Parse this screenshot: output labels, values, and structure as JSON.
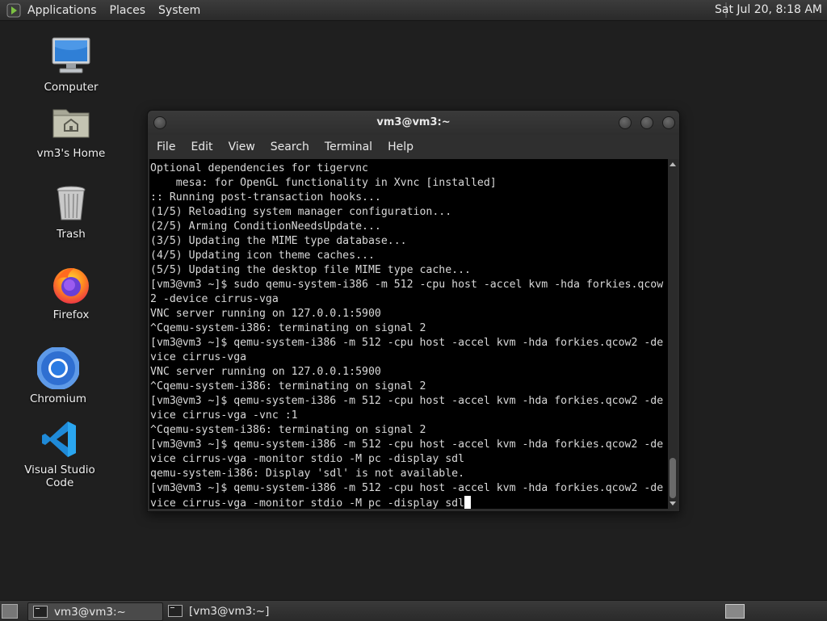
{
  "top_panel": {
    "menus": [
      "Applications",
      "Places",
      "System"
    ],
    "clock": "Sat Jul 20,  8:18 AM"
  },
  "desktop_icons": [
    {
      "label": "Computer",
      "icon": "computer-icon"
    },
    {
      "label": "vm3's Home",
      "icon": "home-folder-icon"
    },
    {
      "label": "Trash",
      "icon": "trash-icon"
    },
    {
      "label": "Firefox",
      "icon": "firefox-icon"
    },
    {
      "label": "Chromium",
      "icon": "chromium-icon"
    },
    {
      "label": "Visual Studio Code",
      "icon": "vscode-icon"
    }
  ],
  "window": {
    "title": "vm3@vm3:~",
    "menu": [
      "File",
      "Edit",
      "View",
      "Search",
      "Terminal",
      "Help"
    ],
    "terminal_lines": [
      "Optional dependencies for tigervnc",
      "    mesa: for OpenGL functionality in Xvnc [installed]",
      ":: Running post-transaction hooks...",
      "(1/5) Reloading system manager configuration...",
      "(2/5) Arming ConditionNeedsUpdate...",
      "(3/5) Updating the MIME type database...",
      "(4/5) Updating icon theme caches...",
      "(5/5) Updating the desktop file MIME type cache...",
      "[vm3@vm3 ~]$ sudo qemu-system-i386 -m 512 -cpu host -accel kvm -hda forkies.qcow",
      "2 -device cirrus-vga",
      "VNC server running on 127.0.0.1:5900",
      "^Cqemu-system-i386: terminating on signal 2",
      "[vm3@vm3 ~]$ qemu-system-i386 -m 512 -cpu host -accel kvm -hda forkies.qcow2 -de",
      "vice cirrus-vga",
      "VNC server running on 127.0.0.1:5900",
      "^Cqemu-system-i386: terminating on signal 2",
      "[vm3@vm3 ~]$ qemu-system-i386 -m 512 -cpu host -accel kvm -hda forkies.qcow2 -de",
      "vice cirrus-vga -vnc :1",
      "^Cqemu-system-i386: terminating on signal 2",
      "[vm3@vm3 ~]$ qemu-system-i386 -m 512 -cpu host -accel kvm -hda forkies.qcow2 -de",
      "vice cirrus-vga -monitor stdio -M pc -display sdl",
      "qemu-system-i386: Display 'sdl' is not available.",
      "[vm3@vm3 ~]$ qemu-system-i386 -m 512 -cpu host -accel kvm -hda forkies.qcow2 -de",
      "vice cirrus-vga -monitor stdio -M pc -display sdl"
    ]
  },
  "taskbar": {
    "tasks": [
      "vm3@vm3:~",
      "[vm3@vm3:~]"
    ]
  }
}
